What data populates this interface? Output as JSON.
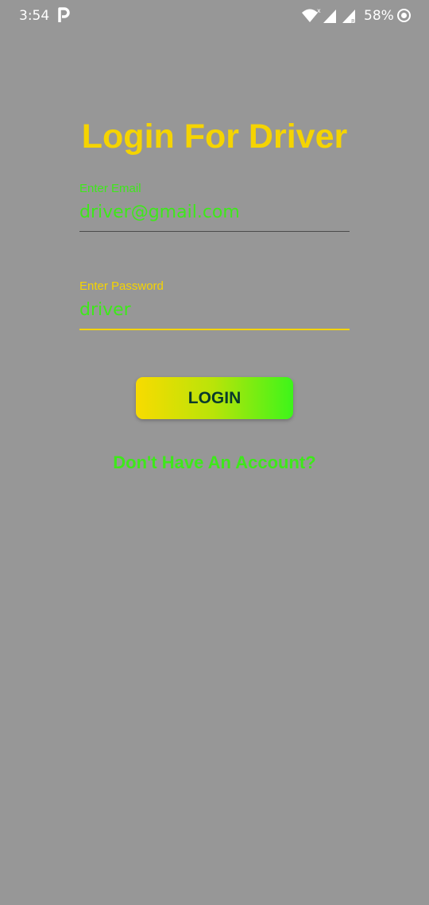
{
  "status_bar": {
    "time": "3:54",
    "battery": "58%",
    "icons": [
      "parking-icon",
      "wifi-icon",
      "signal-icon",
      "signal-icon",
      "battery-icon"
    ]
  },
  "login": {
    "title": "Login For Driver",
    "email_label": "Enter Email",
    "email_value": "driver@gmail.com",
    "password_label": "Enter Password",
    "password_value": "driver",
    "button_label": "LOGIN",
    "signup_link": "Don't Have An Account?"
  },
  "colors": {
    "background": "#979797",
    "title": "#f5d400",
    "accent_green": "#3ee81a",
    "button_gradient_start": "#f8db00",
    "button_gradient_end": "#3df51a",
    "button_text": "#083a2c"
  }
}
